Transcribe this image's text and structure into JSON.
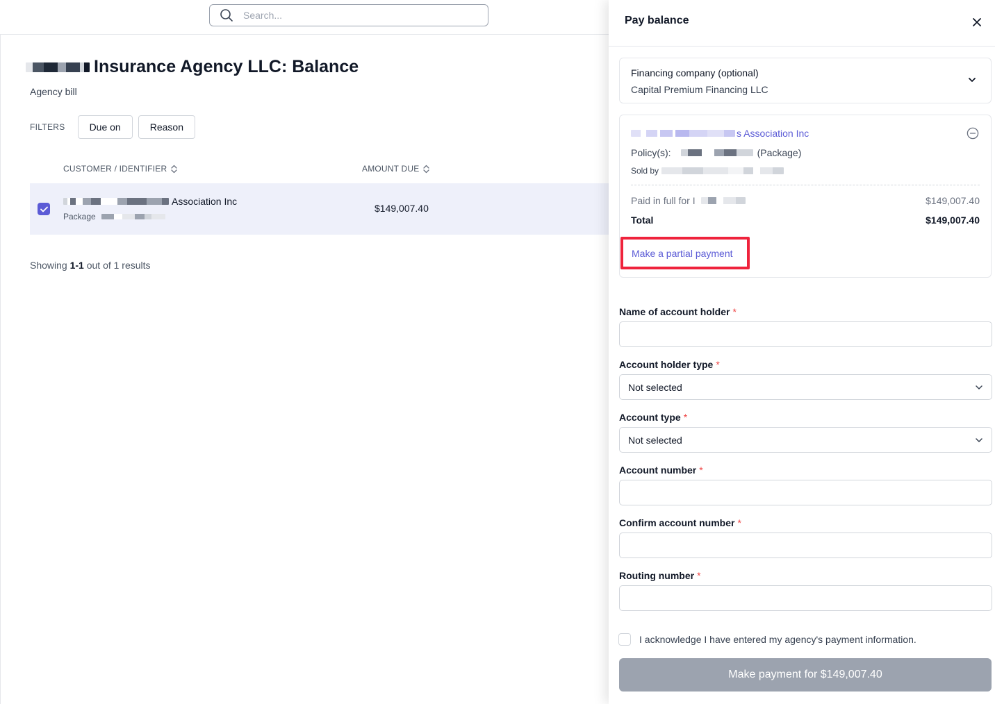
{
  "search": {
    "placeholder": "Search..."
  },
  "page": {
    "title_suffix": "Insurance Agency LLC: Balance",
    "subtitle": "Agency bill"
  },
  "filters": {
    "label": "FILTERS",
    "buttons": [
      "Due on",
      "Reason"
    ]
  },
  "table": {
    "columns": [
      "CUSTOMER / IDENTIFIER",
      "AMOUNT DUE"
    ],
    "rows": [
      {
        "customer_suffix": "Association Inc",
        "identifier_prefix": "Package",
        "amount": "$149,007.40",
        "selected": true
      }
    ]
  },
  "results": {
    "prefix": "Showing",
    "range": "1-1",
    "suffix": "out of 1 results"
  },
  "drawer": {
    "title": "Pay balance",
    "financing": {
      "label": "Financing company (optional)",
      "value": "Capital Premium Financing LLC"
    },
    "card": {
      "customer_suffix": "s Association Inc",
      "policy_label": "Policy(s):",
      "policy_suffix": "(Package)",
      "sold_by_label": "Sold by",
      "paid_label": "Paid in full for I",
      "paid_amount": "$149,007.40",
      "total_label": "Total",
      "total_amount": "$149,007.40",
      "partial_link": "Make a partial payment"
    },
    "fields": {
      "account_holder_name": {
        "label": "Name of account holder"
      },
      "account_holder_type": {
        "label": "Account holder type",
        "value": "Not selected"
      },
      "account_type": {
        "label": "Account type",
        "value": "Not selected"
      },
      "account_number": {
        "label": "Account number"
      },
      "confirm_account_number": {
        "label": "Confirm account number"
      },
      "routing_number": {
        "label": "Routing number"
      },
      "required_mark": "*"
    },
    "acknowledge": "I acknowledge I have entered my agency's payment information.",
    "submit": "Make payment for $149,007.40"
  },
  "colors": {
    "accent": "#5b5bd6",
    "highlight": "#ef233c",
    "disabled_button": "#9ca3af",
    "row_selected": "#eef0fa"
  }
}
